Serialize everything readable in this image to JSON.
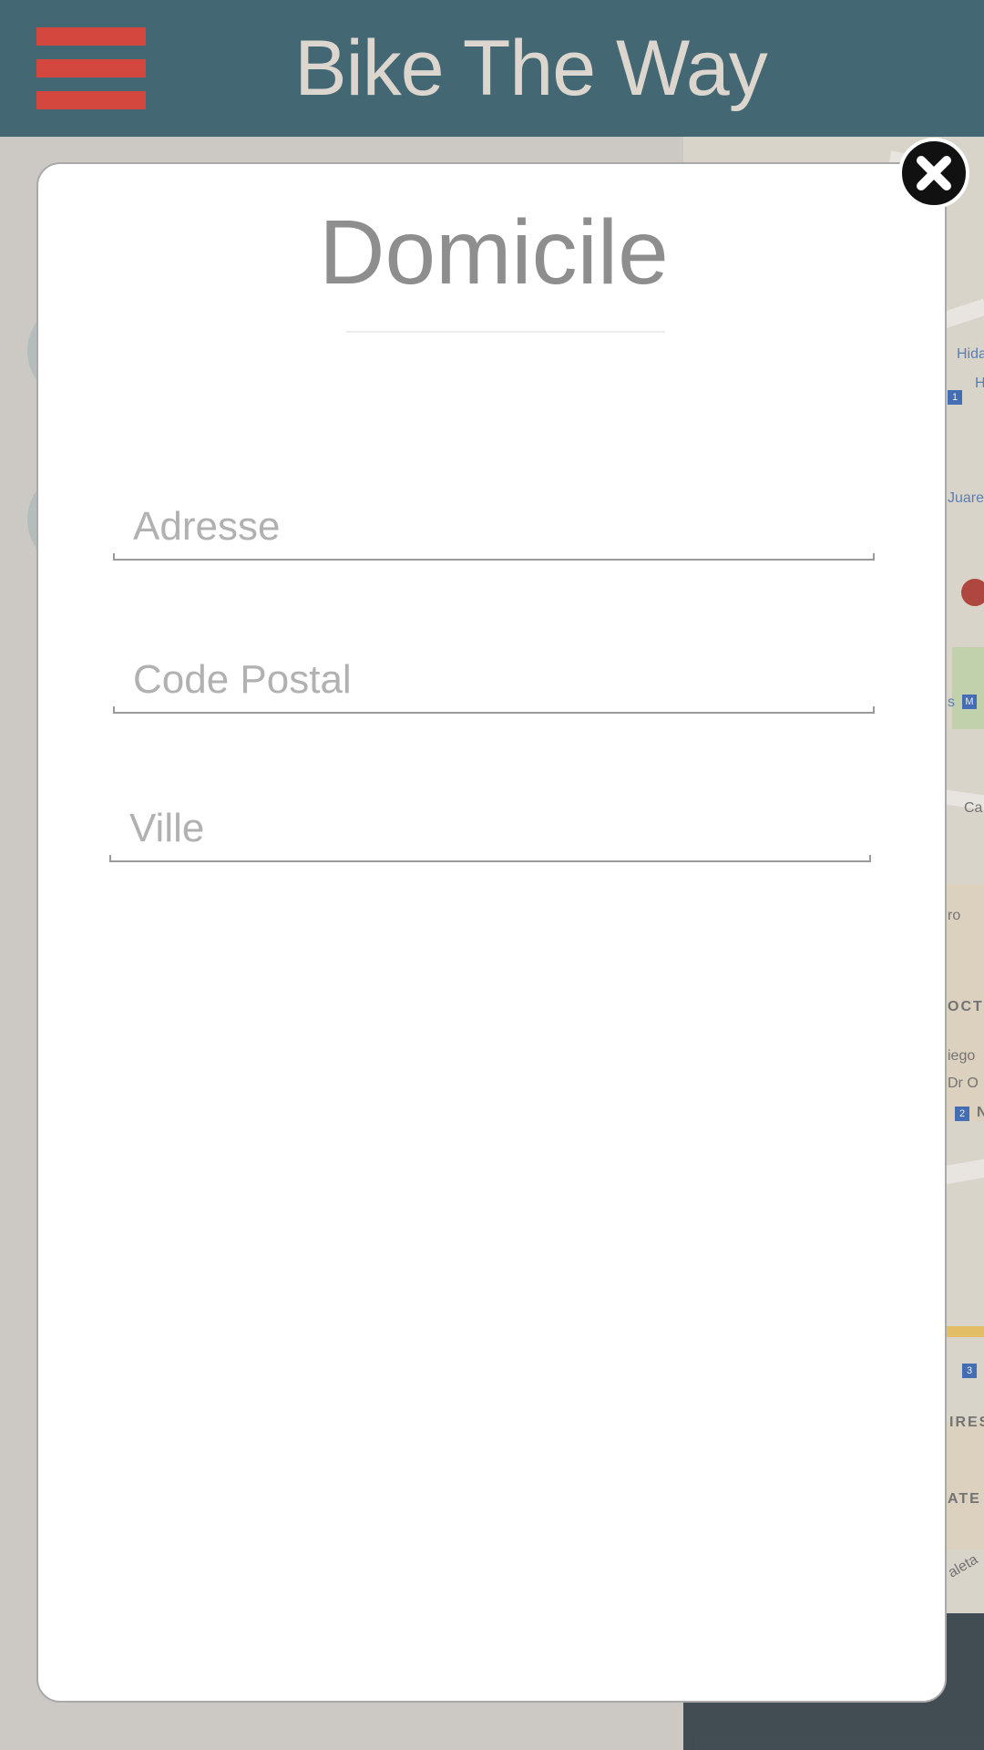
{
  "header": {
    "app_title": "Bike The Way",
    "menu_icon": "hamburger-menu-icon"
  },
  "colors": {
    "header_bg": "#436874",
    "menu_accent": "#d4473f",
    "title_text": "#dcd6cf",
    "modal_title": "#8e8e8e",
    "placeholder": "#b1b1b1"
  },
  "modal": {
    "title": "Domicile",
    "close_icon": "close-x-icon",
    "fields": [
      {
        "placeholder": "Adresse",
        "value": ""
      },
      {
        "placeholder": "Code Postal",
        "value": ""
      },
      {
        "placeholder": "Ville",
        "value": ""
      }
    ]
  },
  "map": {
    "labels": [
      "Hida",
      "H",
      "Juare",
      "s",
      "Ca",
      "ro",
      "OCT",
      "iego",
      "Dr O",
      "N",
      "IRES",
      "ATE",
      "aleta"
    ],
    "badges": [
      "1",
      "M",
      "2",
      "3"
    ]
  }
}
